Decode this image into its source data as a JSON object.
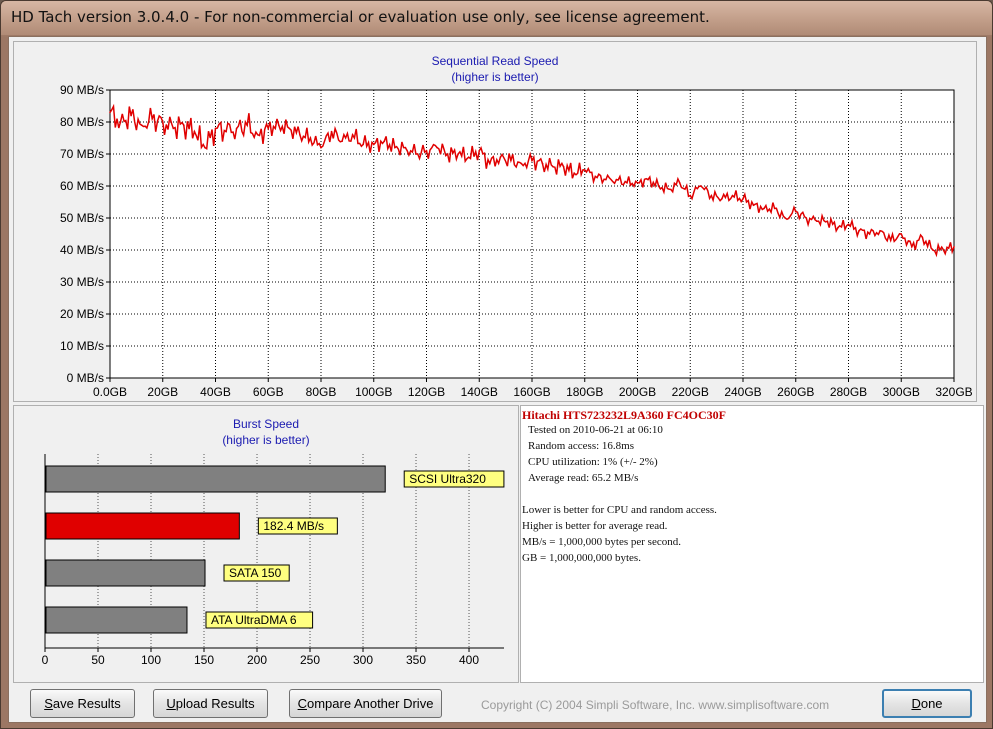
{
  "window": {
    "title": "HD Tach version 3.0.4.0  - For non-commercial or evaluation use only, see license agreement."
  },
  "read_chart": {
    "title": "Sequential Read Speed",
    "subtitle": "(higher is better)"
  },
  "burst_chart": {
    "title": "Burst Speed",
    "subtitle": "(higher is better)"
  },
  "chart_data": [
    {
      "type": "line",
      "title": "Sequential Read Speed",
      "subtitle": "(higher is better)",
      "x_unit": "GB",
      "y_unit": "MB/s",
      "xlim": [
        0,
        320
      ],
      "ylim": [
        0,
        90
      ],
      "x_ticks": [
        "0.0GB",
        "20GB",
        "40GB",
        "60GB",
        "80GB",
        "100GB",
        "120GB",
        "140GB",
        "160GB",
        "180GB",
        "200GB",
        "220GB",
        "240GB",
        "260GB",
        "280GB",
        "300GB",
        "320GB"
      ],
      "y_ticks": [
        "0 MB/s",
        "10 MB/s",
        "20 MB/s",
        "30 MB/s",
        "40 MB/s",
        "50 MB/s",
        "60 MB/s",
        "70 MB/s",
        "80 MB/s",
        "90 MB/s"
      ],
      "grid": true,
      "series": [
        {
          "color": "#e00000",
          "x": [
            0,
            4,
            8,
            12,
            16,
            20,
            24,
            28,
            32,
            36,
            40,
            44,
            48,
            52,
            56,
            60,
            64,
            68,
            72,
            76,
            80,
            84,
            88,
            92,
            96,
            100,
            104,
            108,
            112,
            116,
            120,
            124,
            128,
            132,
            136,
            140,
            144,
            148,
            152,
            156,
            160,
            164,
            168,
            172,
            176,
            180,
            184,
            188,
            192,
            196,
            200,
            204,
            208,
            212,
            216,
            220,
            224,
            228,
            232,
            236,
            240,
            244,
            248,
            252,
            256,
            260,
            264,
            268,
            272,
            276,
            280,
            284,
            288,
            292,
            296,
            300,
            304,
            308,
            312,
            316,
            320
          ],
          "values": [
            83,
            80,
            82,
            79,
            81,
            80,
            78,
            79,
            77,
            72,
            78,
            77,
            78,
            79,
            76,
            78,
            79,
            78,
            76,
            75,
            72,
            77,
            74,
            76,
            73,
            73,
            74,
            72,
            72,
            70,
            71,
            72,
            70,
            70,
            69,
            71,
            67,
            69,
            68,
            67,
            68,
            67,
            66,
            66,
            64,
            65,
            63,
            62,
            62,
            61,
            61,
            62,
            60,
            59,
            61,
            57,
            60,
            57,
            56,
            57,
            56,
            54,
            53,
            53,
            50,
            52,
            50,
            49,
            49,
            47,
            48,
            46,
            45,
            46,
            43,
            45,
            41,
            44,
            40,
            40,
            41
          ]
        }
      ]
    },
    {
      "type": "bar",
      "title": "Burst Speed",
      "subtitle": "(higher is better)",
      "orientation": "horizontal",
      "xlim": [
        0,
        433
      ],
      "x_ticks": [
        "0",
        "50",
        "100",
        "150",
        "200",
        "250",
        "300",
        "350",
        "400"
      ],
      "grid": true,
      "categories": [
        "SCSI Ultra320",
        "182.4 MB/s",
        "SATA 150",
        "ATA UltraDMA 6"
      ],
      "values": [
        320,
        182.4,
        150,
        133
      ],
      "colors": [
        "#808080",
        "#e00000",
        "#808080",
        "#808080"
      ]
    }
  ],
  "info": {
    "drive_name": "Hitachi HTS723232L9A360 FC4OC30F",
    "tested_on": "Tested on 2010-06-21 at 06:10",
    "random_access": "Random access: 16.8ms",
    "cpu_utilization": "CPU utilization: 1% (+/- 2%)",
    "average_read": "Average read: 65.2 MB/s",
    "note1": "Lower is better for CPU and random access.",
    "note2": "Higher is better for average read.",
    "note3": "MB/s = 1,000,000 bytes per second.",
    "note4": "GB = 1,000,000,000 bytes."
  },
  "buttons": {
    "save_first": "S",
    "save_rest": "ave Results",
    "upload_first": "U",
    "upload_rest": "pload Results",
    "compare_first": "C",
    "compare_rest": "ompare Another Drive",
    "done_first": "D",
    "done_rest": "one"
  },
  "copyright": "Copyright (C) 2004 Simpli Software, Inc. www.simplisoftware.com"
}
